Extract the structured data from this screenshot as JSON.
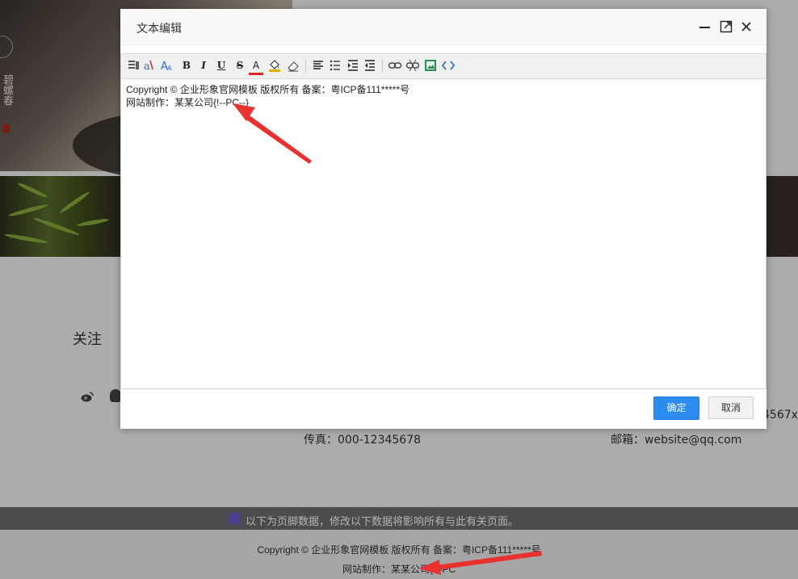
{
  "background_page": {
    "hero_vertical_text": "碧螺春",
    "follow_label": "关注",
    "fax": "传真：000-12345678",
    "email": "邮箱：website@qq.com",
    "phone_tail": "4567x",
    "footer_notice": "以下为页脚数据，修改以下数据将影响所有与此有关页面。",
    "footer_copyright": "Copyright © 企业形象官网模板 版权所有 备案：粤ICP备111*****号",
    "footer_made_by": "网站制作：某某公司{!--PC"
  },
  "dialog": {
    "title": "文本编辑",
    "toolbar": {
      "bold": "B",
      "italic": "I",
      "underline": "U",
      "strikethrough": "S",
      "font_color": "A"
    },
    "content": {
      "line1": "Copyright © 企业形象官网模板 版权所有 备案：粤ICP备111*****号",
      "line2": "网站制作：某某公司{!--PC--}"
    },
    "confirm_label": "确定",
    "cancel_label": "取消"
  },
  "colors": {
    "primary_button": "#2d8cf0",
    "annotation_arrow": "#e8322d"
  }
}
